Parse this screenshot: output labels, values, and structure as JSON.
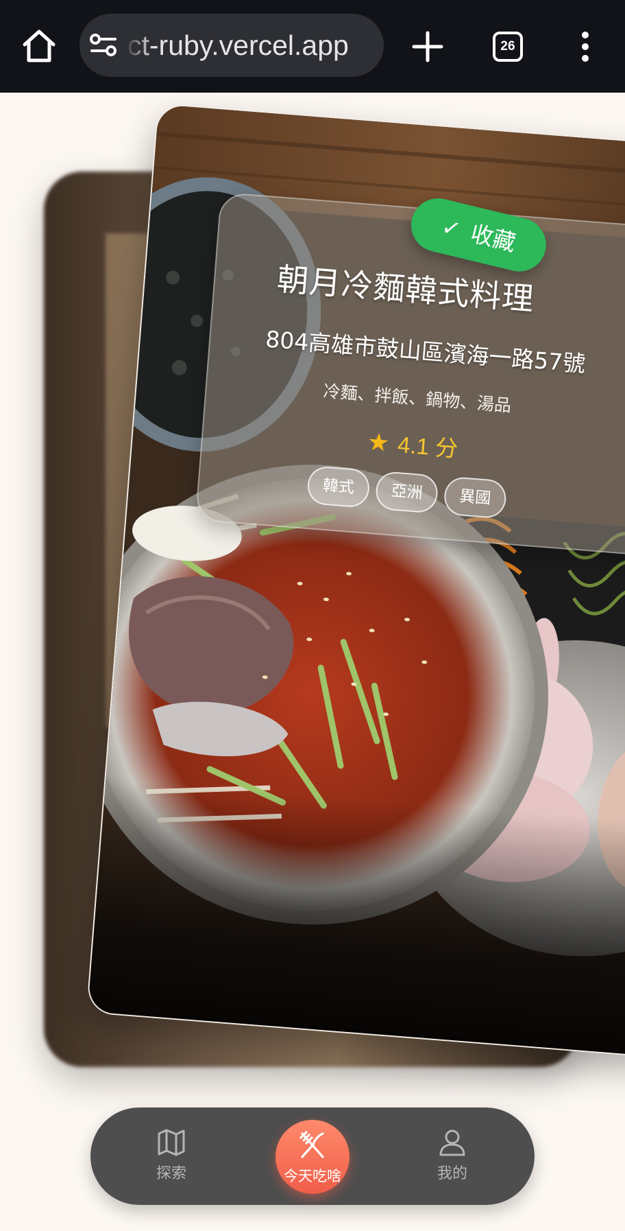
{
  "browser": {
    "url_text": "ct-ruby.vercel.app",
    "tab_count": "26",
    "icons": [
      "home-icon",
      "site-settings-icon",
      "plus-icon",
      "tab-switcher-icon",
      "more-vert-icon"
    ]
  },
  "card": {
    "saved_label": "收藏",
    "saved_check": "✓",
    "name": "朝月冷麵韓式料理",
    "address": "804高雄市鼓山區濱海一路57號",
    "cuisine_items": "冷麵、拌飯、鍋物、湯品",
    "rating_star": "★",
    "rating": "4.1 分",
    "tags": [
      "韓式",
      "亞洲",
      "異國"
    ]
  },
  "nav": {
    "items": [
      {
        "label": "探索",
        "icon": "map-icon"
      },
      {
        "label": "今天吃啥",
        "icon": "utensils-icon",
        "active": true
      },
      {
        "label": "我的",
        "icon": "user-icon"
      }
    ]
  },
  "colors": {
    "background": "#fcf7f2",
    "browser_bar": "#121318",
    "saved_badge": "#2db85a",
    "rating": "#f7c531",
    "nav_bg": "#484848",
    "nav_active": "#f05e4a"
  }
}
